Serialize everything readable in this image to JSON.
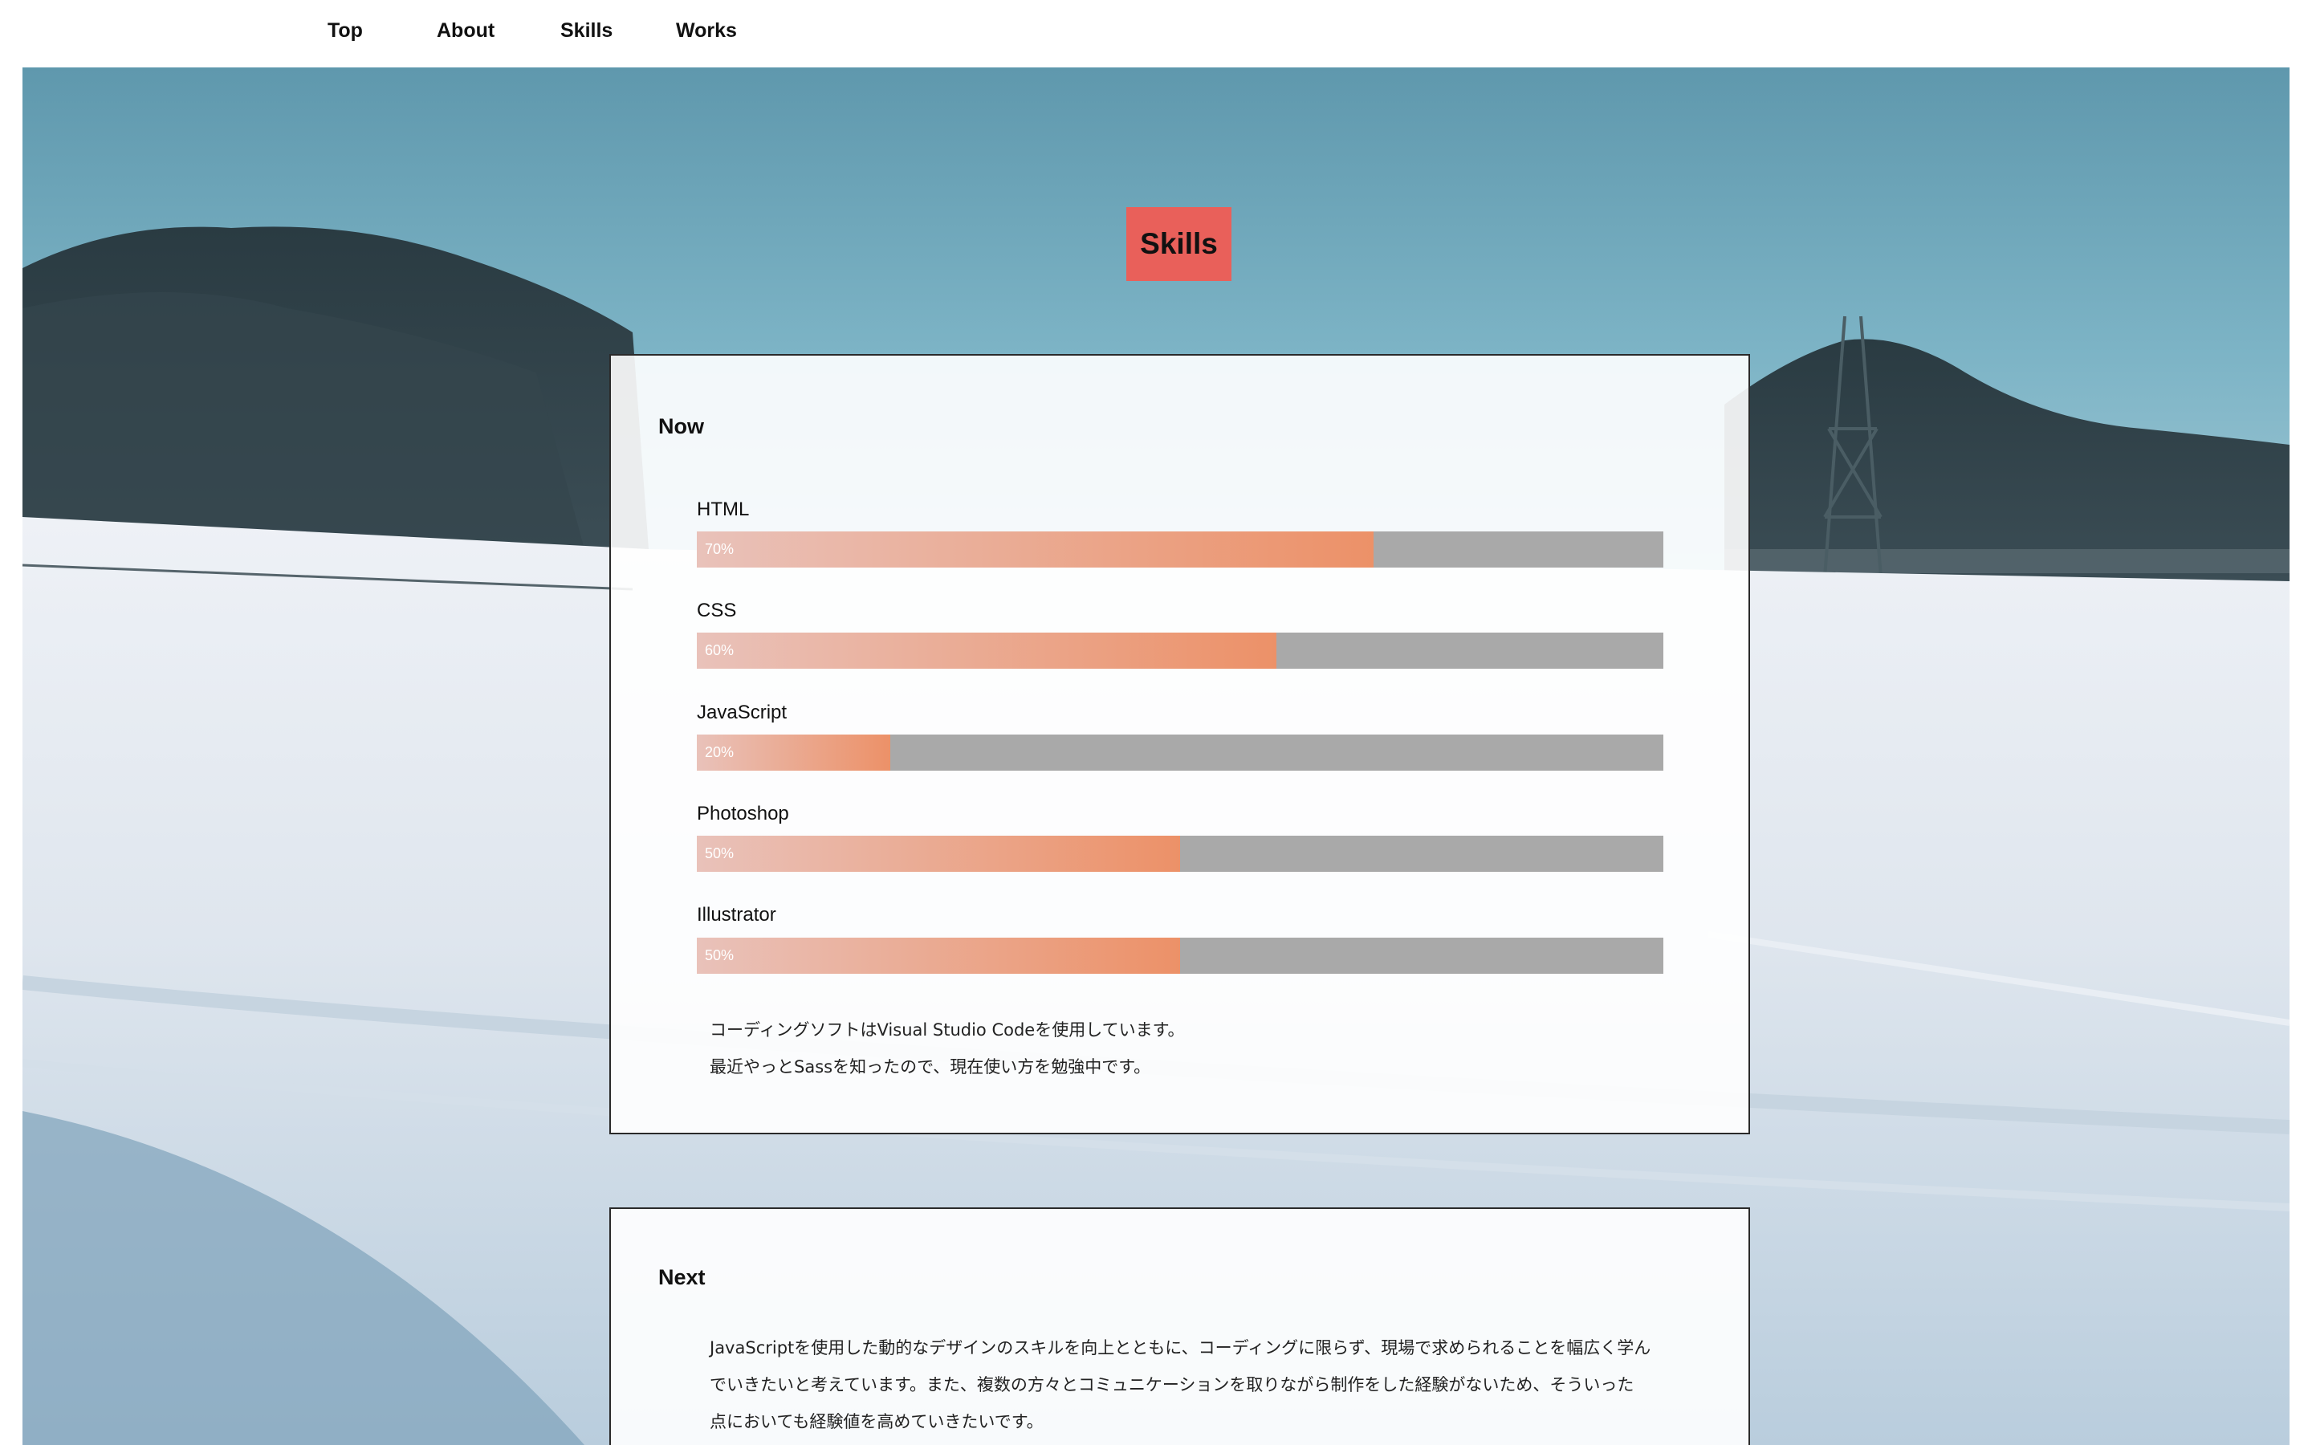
{
  "nav": {
    "items": [
      {
        "label": "Top"
      },
      {
        "label": "About"
      },
      {
        "label": "Skills"
      },
      {
        "label": "Works"
      }
    ]
  },
  "section": {
    "title": "Skills"
  },
  "now": {
    "heading": "Now",
    "skills": [
      {
        "name": "HTML",
        "percent_label": "70%",
        "level": 0.7
      },
      {
        "name": "CSS",
        "percent_label": "60%",
        "level": 0.6
      },
      {
        "name": "JavaScript",
        "percent_label": "20%",
        "level": 0.2
      },
      {
        "name": "Photoshop",
        "percent_label": "50%",
        "level": 0.5
      },
      {
        "name": "Illustrator",
        "percent_label": "50%",
        "level": 0.5
      }
    ],
    "notes": [
      "コーディングソフトはVisual Studio Codeを使用しています。",
      "最近やっとSassを知ったので、現在使い方を勉強中です。"
    ]
  },
  "next": {
    "heading": "Next",
    "lines": [
      "JavaScriptを使用した動的なデザインのスキルを向上とともに、コーディングに限らず、現場で求められることを幅広く学ん",
      "でいきたいと考えています。また、複数の方々とコミュニケーションを取りながら制作をした経験がないため、そういった",
      "点においても経験値を高めていきたいです。"
    ]
  },
  "colors": {
    "title_bg": "#e9605a",
    "bar_track": "#a9a9a9",
    "bar_fill_start": "#e9c2ba",
    "bar_fill_end": "#ec9168"
  }
}
